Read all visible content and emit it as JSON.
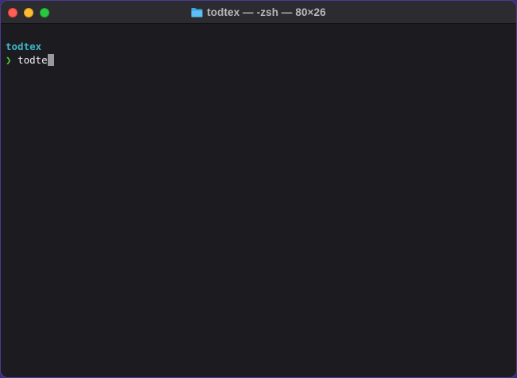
{
  "window": {
    "title": "todtex — -zsh — 80×26",
    "title_icon": "folder-icon",
    "buttons": {
      "close": "close",
      "minimize": "minimize",
      "zoom": "zoom"
    }
  },
  "terminal": {
    "directory": "todtex",
    "prompt_symbol": "❯",
    "command_input": "todte"
  },
  "colors": {
    "background": "#1c1b1f",
    "titlebar": "#2c2b30",
    "directory": "#3fb6c9",
    "prompt": "#4fc936",
    "text": "#f2f2f2",
    "cursor": "#9a999e",
    "close": "#ff5f57",
    "minimize": "#febc2e",
    "zoom": "#28c840"
  }
}
